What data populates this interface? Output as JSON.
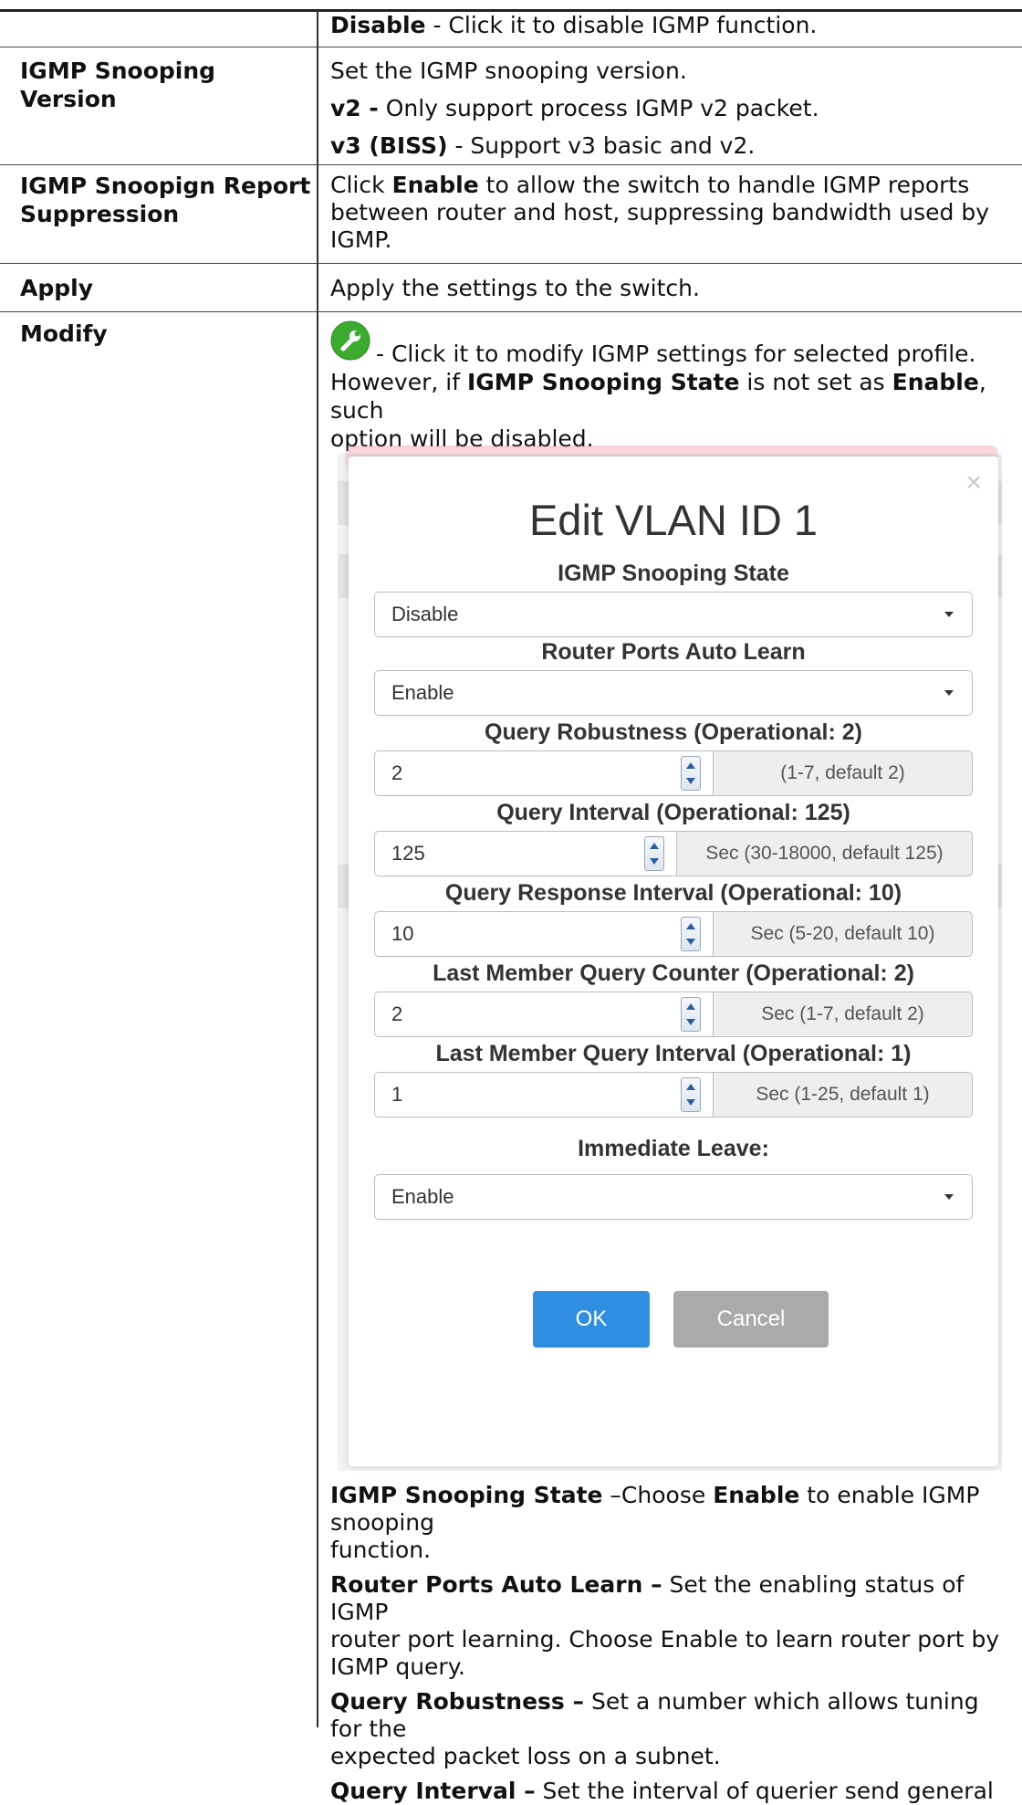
{
  "rows": {
    "disable": {
      "term": "Disable",
      "text": " - Click it to disable IGMP function."
    },
    "version": {
      "label": "IGMP Snooping Version",
      "line1": "Set the IGMP snooping version.",
      "v2_term": "v2 -",
      "v2_text": " Only support process IGMP v2 packet.",
      "v3_term": "v3 (BISS)",
      "v3_text": " - Support v3 basic and v2."
    },
    "suppression": {
      "label_line1": "IGMP Snoopign Report",
      "label_line2": "Suppression",
      "pre": "Click ",
      "term": "Enable",
      "post1": " to allow the switch to handle IGMP reports",
      "line2": "between router and host, suppressing bandwidth used by",
      "line3": "IGMP."
    },
    "apply": {
      "label": "Apply",
      "text": "Apply the settings to the switch."
    },
    "modify": {
      "label": "Modify",
      "line1": "- Click it to modify IGMP settings for selected profile.",
      "l2_pre": "However, if ",
      "l2_term1": "IGMP Snooping State",
      "l2_mid": " is not set as ",
      "l2_term2": "Enable",
      "l2_post": ", such",
      "line3": "option will be disabled."
    }
  },
  "modal": {
    "close_symbol": "×",
    "title": "Edit VLAN ID 1",
    "state_label": "IGMP Snooping State",
    "state_value": "Disable",
    "autolearn_label": "Router Ports Auto Learn",
    "autolearn_value": "Enable",
    "robustness_label": "Query Robustness (Operational: 2)",
    "robustness_value": "2",
    "robustness_hint": "(1-7, default 2)",
    "interval_label": "Query Interval (Operational: 125)",
    "interval_value": "125",
    "interval_hint": "Sec (30-18000, default 125)",
    "response_label": "Query Response Interval (Operational: 10)",
    "response_value": "10",
    "response_hint": "Sec (5-20, default 10)",
    "lmq_counter_label": "Last Member Query Counter (Operational: 2)",
    "lmq_counter_value": "2",
    "lmq_counter_hint": "Sec (1-7, default 2)",
    "lmq_interval_label": "Last Member Query Interval (Operational: 1)",
    "lmq_interval_value": "1",
    "lmq_interval_hint": "Sec (1-25, default 1)",
    "leave_label": "Immediate Leave:",
    "leave_value": "Enable",
    "ok": "OK",
    "cancel": "Cancel"
  },
  "notes": {
    "state_term": "IGMP Snooping State",
    "state_mid": " –Choose ",
    "state_term2": "Enable",
    "state_post": " to enable IGMP snooping",
    "state_line2": "function.",
    "autolearn_term": "Router Ports Auto Learn –",
    "autolearn_text": " Set the enabling status of IGMP",
    "autolearn_line2": "router port learning. Choose Enable to learn router port by",
    "autolearn_line3": "IGMP query.",
    "robust_term": "Query Robustness –",
    "robust_text": " Set a number which allows tuning for the",
    "robust_line2": "expected packet loss on a subnet.",
    "interval_term": "Query Interval –",
    "interval_text": " Set the interval of querier send general"
  },
  "colors": {
    "ok": "#2f8ee0",
    "cancel": "#aaaaaa",
    "modify_icon": "#3cab2f"
  }
}
